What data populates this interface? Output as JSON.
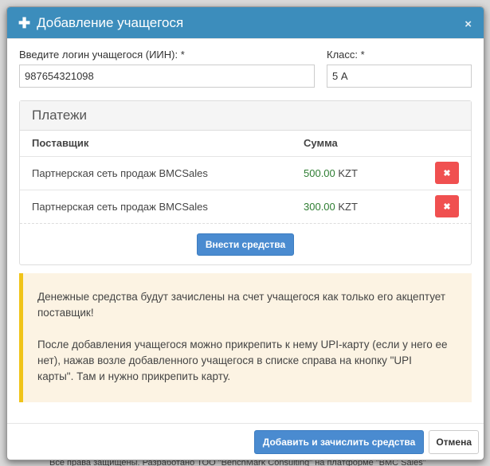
{
  "backdrop": {
    "footer_text": "Все права защищены. Разработано ТОО \"BenchMark Consulting\" на платформе \"BMC Sales\""
  },
  "modal": {
    "title": "Добавление учащегося",
    "close_symbol": "×",
    "login": {
      "label": "Введите логин учащегося (ИИН): *",
      "value": "987654321098"
    },
    "class_field": {
      "label": "Класс: *",
      "value": "5 А"
    },
    "payments": {
      "heading": "Платежи",
      "columns": [
        "Поставщик",
        "Сумма"
      ],
      "rows": [
        {
          "provider": "Партнерская сеть продаж BMCSales",
          "amount": "500.00",
          "currency": "KZT"
        },
        {
          "provider": "Партнерская сеть продаж BMCSales",
          "amount": "300.00",
          "currency": "KZT"
        }
      ],
      "add_funds_label": "Внести средства"
    },
    "notice": {
      "paragraph1": "Денежные средства будут зачислены на счет учащегося как только его акцептует поставщик!",
      "paragraph2": "После добавления учащегося можно прикрепить к нему UPI-карту (если у него ее нет), нажав возле добавленного учащегося в списке справа на кнопку \"UPI карты\". Там и нужно прикрепить карту."
    },
    "footer": {
      "submit_label": "Добавить и зачислить средства",
      "cancel_label": "Отмена"
    }
  },
  "colors": {
    "header_bg": "#3c8dbc",
    "amount_green": "#2e7d32",
    "delete_red": "#f05050",
    "alert_border": "#f0c419",
    "alert_bg": "#fcf3e3"
  }
}
